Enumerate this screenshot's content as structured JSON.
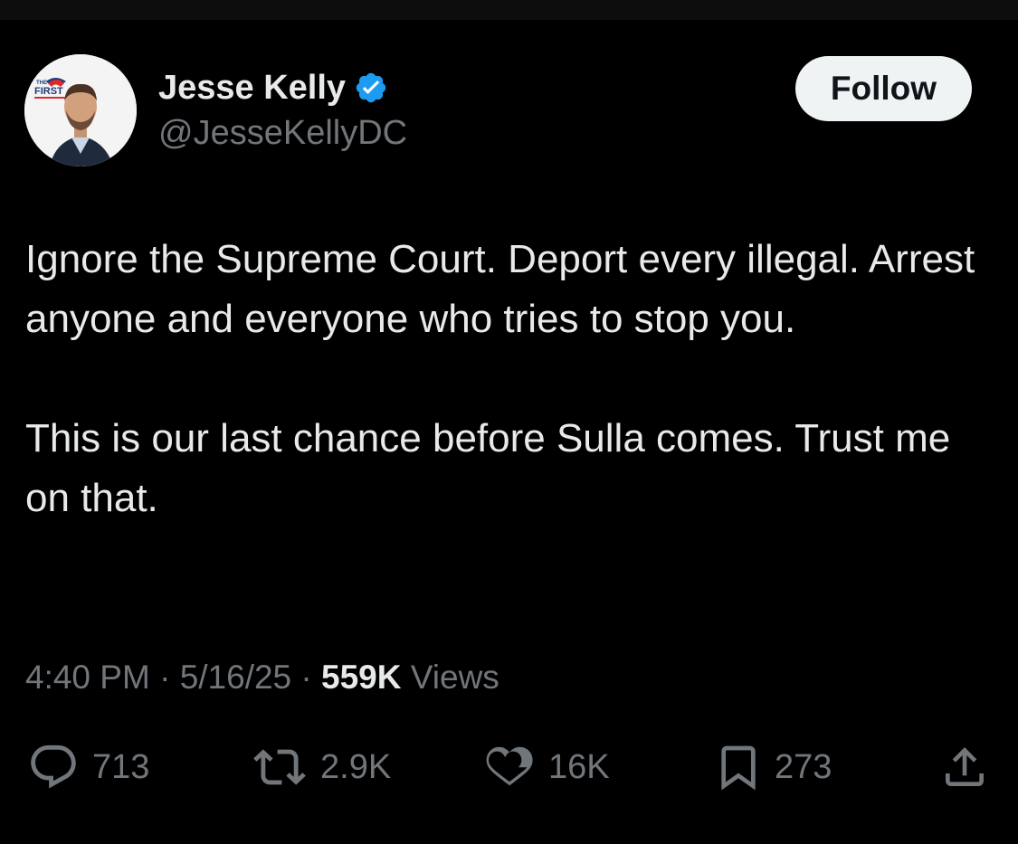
{
  "author": {
    "display_name": "Jesse Kelly",
    "handle": "@JesseKellyDC",
    "verified": true,
    "avatar_logo_top": "THE",
    "avatar_logo_main": "FIRST"
  },
  "follow_label": "Follow",
  "tweet": {
    "paragraphs": [
      "Ignore the Supreme Court. Deport every illegal. Arrest anyone and everyone who tries to stop you.",
      "This is our last chance before Sulla comes. Trust me on that."
    ]
  },
  "meta": {
    "time": "4:40 PM",
    "separator": "·",
    "date": "5/16/25",
    "views_count": "559K",
    "views_label": "Views"
  },
  "actions": {
    "reply_count": "713",
    "repost_count": "2.9K",
    "like_count": "16K",
    "bookmark_count": "273"
  },
  "icons": {
    "reply": "reply-icon",
    "repost": "repost-icon",
    "like": "heart-icon",
    "bookmark": "bookmark-icon",
    "share": "share-icon",
    "verified": "verified-badge-icon"
  },
  "colors": {
    "background": "#000000",
    "primary_text": "#e7e9ea",
    "secondary_text": "#71767b",
    "verified_blue": "#1d9bf0",
    "follow_bg": "#eff3f4"
  }
}
